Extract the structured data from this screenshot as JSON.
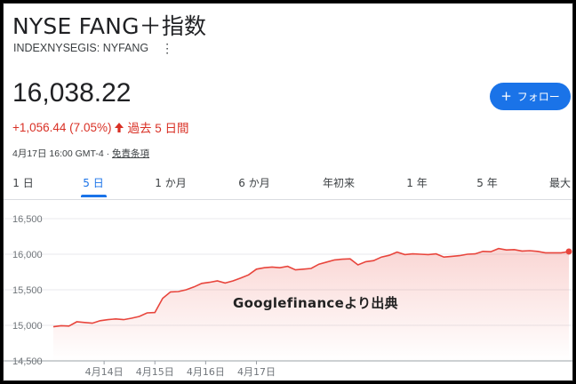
{
  "header": {
    "title": "NYSE FANG＋指数",
    "ticker": "INDEXNYSEGIS: NYFANG",
    "more_icon": "more-vert-icon"
  },
  "quote": {
    "price": "16,038.22",
    "change": "+1,056.44 (7.05%)",
    "period": "過去 5 日間",
    "timestamp": "4月17日 16:00 GMT-4 · ",
    "disclaimer": "免責条項"
  },
  "follow_button": {
    "label": "フォロー",
    "icon": "plus-icon",
    "color": "#1a73e8"
  },
  "tabs": [
    {
      "label": "1 日",
      "active": false
    },
    {
      "label": "5 日",
      "active": true
    },
    {
      "label": "1 か月",
      "active": false
    },
    {
      "label": "6 か月",
      "active": false
    },
    {
      "label": "年初来",
      "active": false
    },
    {
      "label": "1 年",
      "active": false
    },
    {
      "label": "5 年",
      "active": false
    },
    {
      "label": "最大",
      "active": false
    }
  ],
  "watermark": "Googlefinanceより出典",
  "colors": {
    "line": "#e8453c",
    "negative": "#d93025",
    "accent": "#1a73e8"
  },
  "chart_data": {
    "type": "area",
    "ylim": [
      14500,
      16500
    ],
    "yticks": [
      "16,500",
      "16,000",
      "15,500",
      "15,000",
      "14,500"
    ],
    "ytick_values": [
      16500,
      16000,
      15500,
      15000,
      14500
    ],
    "xtick_labels": [
      "4月14日",
      "4月15日",
      "4月16日",
      "4月17日"
    ],
    "xtick_positions": [
      6.5,
      13,
      19.5,
      26
    ],
    "grid": true,
    "series": [
      {
        "values": [
          14980,
          14995,
          14990,
          15050,
          15040,
          15030,
          15065,
          15080,
          15090,
          15080,
          15100,
          15125,
          15175,
          15180,
          15380,
          15470,
          15475,
          15500,
          15540,
          15590,
          15605,
          15625,
          15595,
          15625,
          15665,
          15710,
          15790,
          15810,
          15820,
          15810,
          15830,
          15780,
          15790,
          15800,
          15860,
          15890,
          15920,
          15930,
          15935,
          15850,
          15895,
          15910,
          15960,
          15985,
          16030,
          15995,
          16005,
          16000,
          15995,
          16005,
          15960,
          15970,
          15980,
          16000,
          16005,
          16040,
          16035,
          16080,
          16060,
          16065,
          16045,
          16050,
          16040,
          16020,
          16020,
          16020,
          16038
        ]
      }
    ]
  }
}
